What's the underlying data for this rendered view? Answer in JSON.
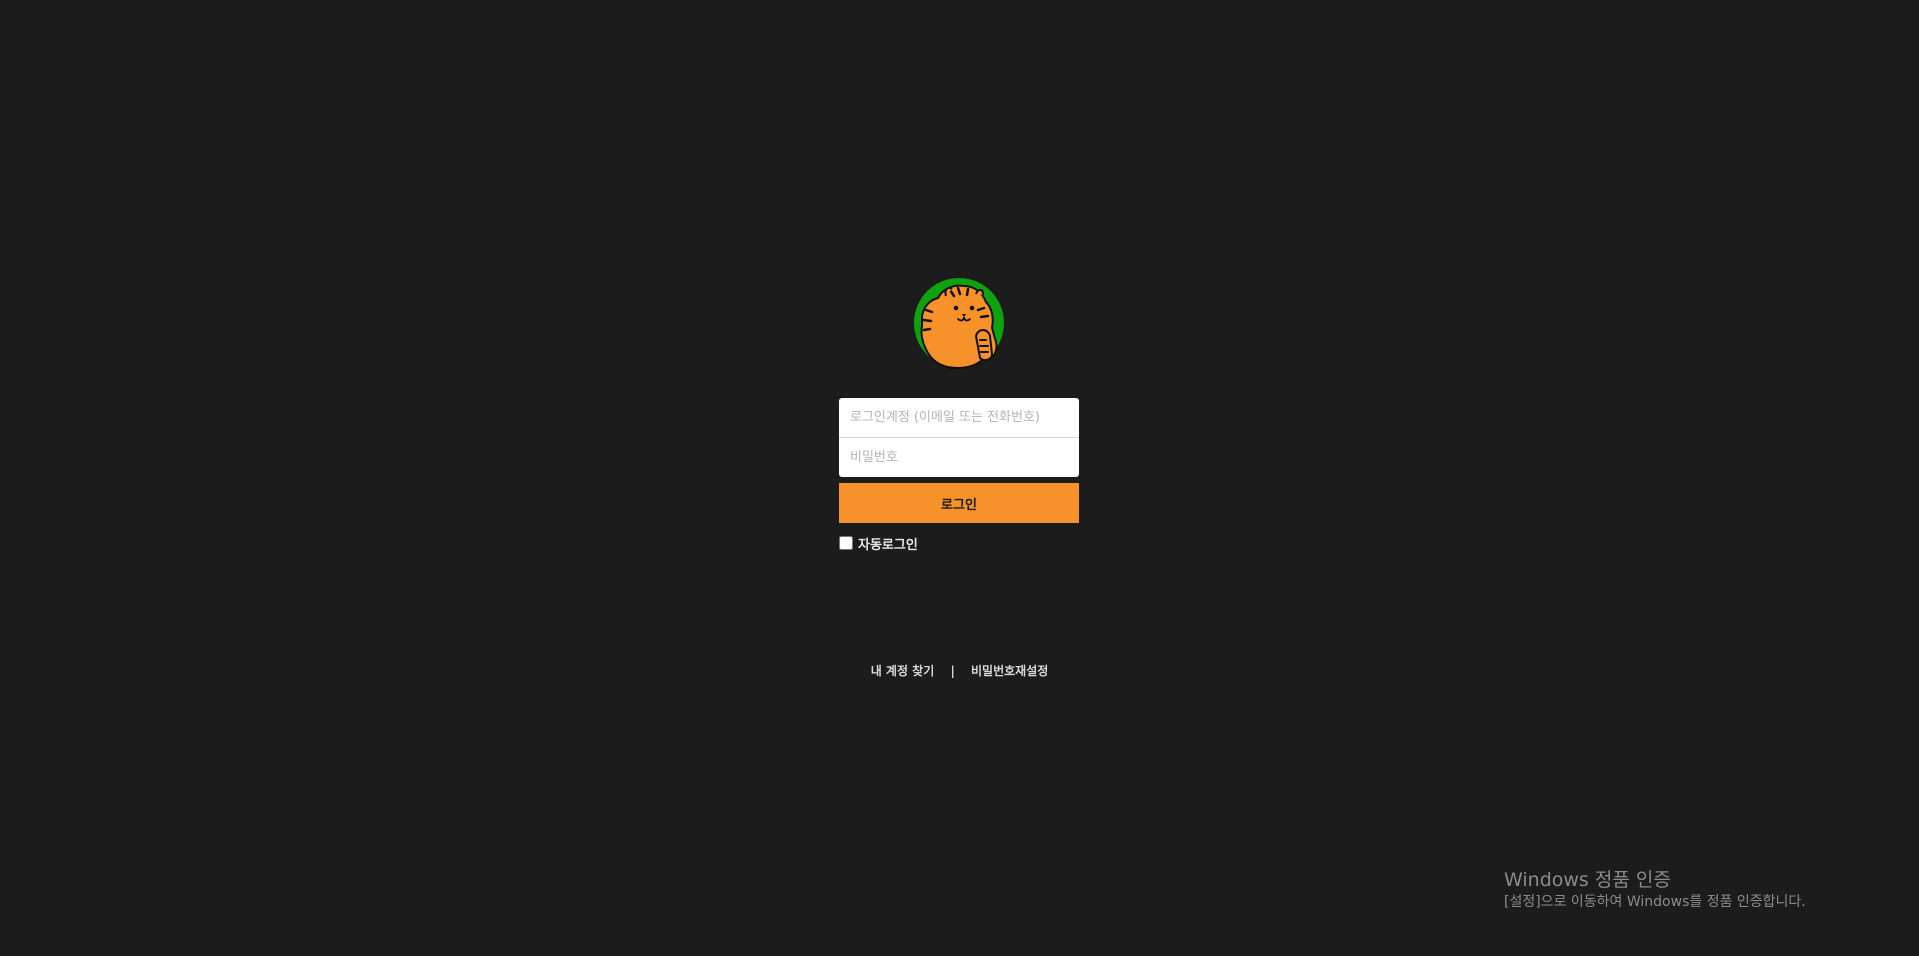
{
  "login": {
    "account_placeholder": "로그인계정 (이메일 또는 전화번호)",
    "password_placeholder": "비밀번호",
    "account_value": "",
    "password_value": "",
    "submit_label": "로그인",
    "auto_login_label": "자동로그인",
    "auto_login_checked": false
  },
  "links": {
    "find_account": "내 계정 찾기",
    "separator": "|",
    "reset_password": "비밀번호재설정"
  },
  "windows_watermark": {
    "title": "Windows 정품 인증",
    "subtitle": "[설정]으로 이동하여 Windows를 정품 인증합니다."
  },
  "colors": {
    "background": "#1c1c1c",
    "accent": "#f7922b",
    "logo_green": "#0ea20e",
    "logo_orange": "#f7922b"
  },
  "icons": {
    "logo": "tiger-logo-icon"
  }
}
